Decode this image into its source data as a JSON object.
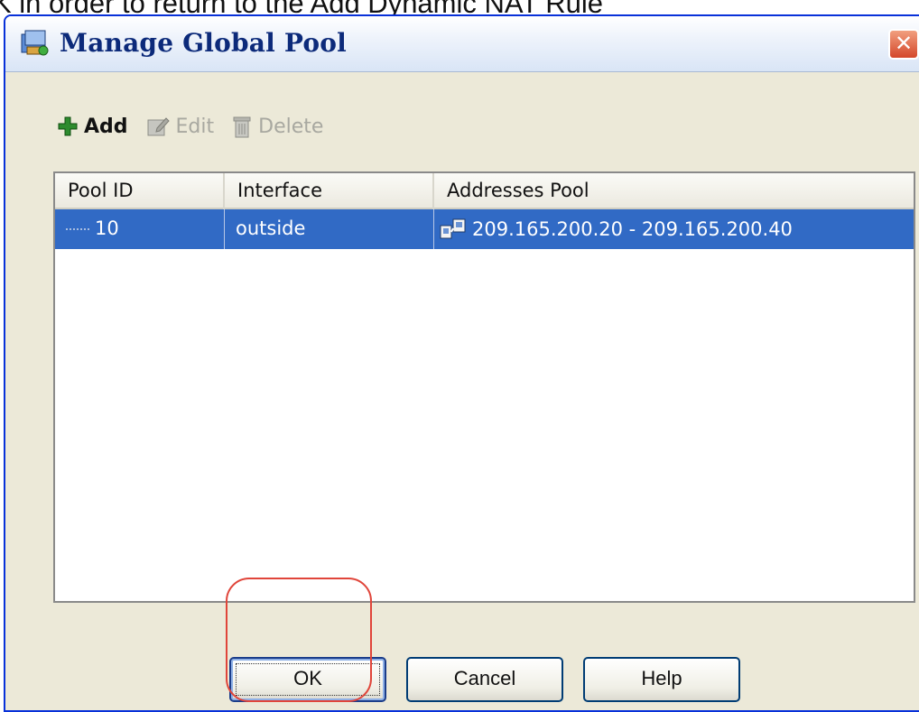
{
  "caption": {
    "text": "K in order to return to the Add Dynamic NAT Rule"
  },
  "window": {
    "title": "Manage Global Pool",
    "close_glyph": "✕"
  },
  "toolbar": {
    "add_label": "Add",
    "edit_label": "Edit",
    "delete_label": "Delete"
  },
  "table": {
    "columns": [
      "Pool ID",
      "Interface",
      "Addresses Pool"
    ],
    "rows": [
      {
        "pool_id": "10",
        "interface": "outside",
        "addresses_pool": "209.165.200.20 - 209.165.200.40",
        "selected": true
      }
    ]
  },
  "buttons": {
    "ok": "OK",
    "cancel": "Cancel",
    "help": "Help"
  },
  "colors": {
    "selection": "#316ac5",
    "title_text": "#0c2a7a",
    "highlight_ring": "#e0453a",
    "dialog_bg": "#ece9d8"
  }
}
